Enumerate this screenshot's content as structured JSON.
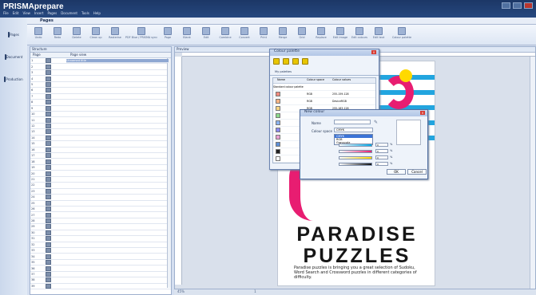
{
  "app": {
    "title": "PRISMAprepare",
    "menu": [
      "File",
      "Edit",
      "View",
      "Insert",
      "Pages",
      "Document",
      "Tools",
      "Help"
    ],
    "window_controls": [
      "minimize",
      "maximize",
      "close"
    ]
  },
  "rail": {
    "items": [
      {
        "label": "Pages"
      },
      {
        "label": "Document"
      },
      {
        "label": "Production"
      }
    ]
  },
  "tab": {
    "label": "Pages"
  },
  "toolbar": {
    "buttons": [
      "Undo",
      "Redo",
      "Delete",
      "Clean up",
      "Rasterise",
      "PDF Blue / PRISMA sync",
      "Page",
      "Blank",
      "Edit",
      "Combine",
      "Convert",
      "Print",
      "Merge",
      "Grid",
      "Replace",
      "Edit image",
      "Edit colours",
      "Edit text",
      "Colour palette"
    ]
  },
  "structure": {
    "title": "Structure",
    "columns": [
      "Page",
      "Page view"
    ],
    "selected_row": "Unnamed title",
    "rows": [
      "1",
      "2",
      "3",
      "4",
      "5",
      "6",
      "7",
      "8",
      "9",
      "10",
      "11",
      "12",
      "13",
      "14",
      "15",
      "16",
      "17",
      "18",
      "19",
      "20",
      "21",
      "22",
      "23",
      "24",
      "25",
      "26",
      "27",
      "28",
      "29",
      "30",
      "31",
      "32",
      "33",
      "34",
      "35",
      "36",
      "37",
      "38",
      "39"
    ]
  },
  "preview": {
    "title": "Preview",
    "zoom": "45%",
    "page_number": "1",
    "headline1": "PARADISE",
    "headline2": "PUZZLES",
    "tagline": "Paradise puzzles is bringing you a great selection of Sudoku, Word Search and Crossword puzzles in different categories of difficulty."
  },
  "palette_dialog": {
    "title": "Colour palette",
    "tab": "My palettes",
    "columns": [
      "Name",
      "Colour space",
      "Colour values"
    ],
    "group": "Standard colour palette",
    "rows": [
      {
        "name": "",
        "space": "RGB",
        "values": "255-159-128"
      },
      {
        "name": "",
        "space": "RGB",
        "values": "DeviceRGB"
      },
      {
        "name": "",
        "space": "RGB",
        "values": "255-183-128"
      },
      {
        "name": "",
        "space": "RGB",
        "values": "DeviceRGB"
      },
      {
        "name": "",
        "space": "RGB",
        "values": "128-255-128"
      },
      {
        "name": "",
        "space": "RGB",
        "values": "DeviceRGB"
      },
      {
        "name": "",
        "space": "RGB",
        "values": "128-128-255"
      },
      {
        "name": "",
        "space": "RGB",
        "values": "DeviceRGB"
      },
      {
        "name": "",
        "space": "RGB",
        "values": "255-255-255"
      },
      {
        "name": "",
        "space": "",
        "values": ""
      }
    ]
  },
  "new_colour": {
    "title": "New colour",
    "name_label": "Name",
    "colour_space_label": "Colour space",
    "colour_space": "CMYK",
    "options": [
      "CMYK",
      "RGB",
      "Grayscale"
    ],
    "c": "0",
    "m": "0",
    "y": "0",
    "k": "0",
    "unit": "%",
    "ok": "OK",
    "cancel": "Cancel"
  },
  "colors": {
    "accent": "#e81d71",
    "blue": "#22a5df",
    "yellow": "#ffd900",
    "toolbar": "#dde6f4"
  }
}
